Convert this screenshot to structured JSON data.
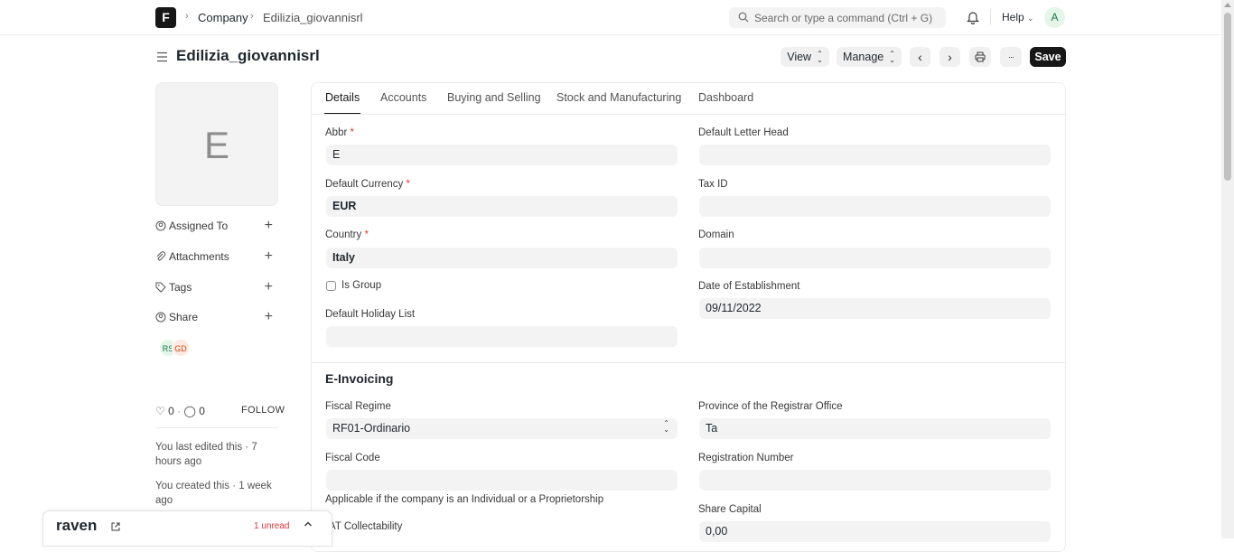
{
  "nav": {
    "logo": "F",
    "breadcrumb": [
      "Company",
      "Edilizia_giovannisrl"
    ],
    "search_placeholder": "Search or type a command (Ctrl + G)",
    "help_label": "Help",
    "avatar_initial": "A"
  },
  "page": {
    "title": "Edilizia_giovannisrl",
    "view_label": "View",
    "manage_label": "Manage",
    "more_label": "···",
    "save_label": "Save"
  },
  "sidebar": {
    "image_initial": "E",
    "assigned_to": "Assigned To",
    "attachments": "Attachments",
    "tags": "Tags",
    "share": "Share",
    "shared_users": [
      "RS",
      "GD"
    ],
    "likes": "0",
    "comments": "0",
    "follow": "FOLLOW",
    "last_edited": "You last edited this · 7 hours ago",
    "created": "You created this · 1 week ago"
  },
  "raven": {
    "name": "raven",
    "unread": "1 unread"
  },
  "tabs": [
    "Details",
    "Accounts",
    "Buying and Selling",
    "Stock and Manufacturing",
    "Dashboard"
  ],
  "form": {
    "abbr_label": "Abbr",
    "abbr_value": "E",
    "letter_head_label": "Default Letter Head",
    "letter_head_value": "",
    "currency_label": "Default Currency",
    "currency_value": "EUR",
    "tax_id_label": "Tax ID",
    "tax_id_value": "",
    "country_label": "Country",
    "country_value": "Italy",
    "domain_label": "Domain",
    "domain_value": "",
    "is_group_label": "Is Group",
    "establishment_label": "Date of Establishment",
    "establishment_value": "09/11/2022",
    "holiday_label": "Default Holiday List",
    "holiday_value": ""
  },
  "einvoicing": {
    "title": "E-Invoicing",
    "fiscal_regime_label": "Fiscal Regime",
    "fiscal_regime_value": "RF01-Ordinario",
    "province_label": "Province of the Registrar Office",
    "province_value": "Ta",
    "fiscal_code_label": "Fiscal Code",
    "fiscal_code_value": "",
    "registration_label": "Registration Number",
    "registration_value": "",
    "fiscal_code_help": "Applicable if the company is an Individual or a Proprietorship",
    "vat_label": "AT Collectability",
    "share_capital_label": "Share Capital",
    "share_capital_value": "0,00"
  }
}
